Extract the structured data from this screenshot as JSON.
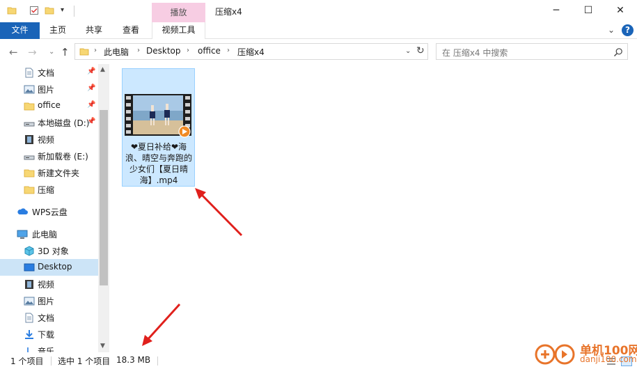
{
  "window": {
    "title": "压缩x4",
    "context_tab": "播放",
    "controls": {
      "minimize": "─",
      "maximize": "☐",
      "close": "✕"
    }
  },
  "ribbon": {
    "tabs": [
      {
        "label": "文件"
      },
      {
        "label": "主页"
      },
      {
        "label": "共享"
      },
      {
        "label": "查看"
      },
      {
        "label": "视频工具"
      }
    ],
    "help": "?"
  },
  "address": {
    "breadcrumbs": [
      "此电脑",
      "Desktop",
      "office",
      "压缩x4"
    ],
    "separator": "›"
  },
  "search": {
    "placeholder": "在 压缩x4 中搜索"
  },
  "sidebar": {
    "items": [
      {
        "label": "文档",
        "icon": "document-icon",
        "pinned": true
      },
      {
        "label": "图片",
        "icon": "picture-icon",
        "pinned": true
      },
      {
        "label": "office",
        "icon": "folder-icon",
        "pinned": true
      },
      {
        "label": "本地磁盘 (D:)",
        "icon": "drive-icon",
        "pinned": true
      },
      {
        "label": "视频",
        "icon": "video-icon",
        "pinned": false
      },
      {
        "label": "新加载卷 (E:)",
        "icon": "drive-icon",
        "pinned": false
      },
      {
        "label": "新建文件夹",
        "icon": "folder-icon",
        "pinned": false
      },
      {
        "label": "压缩",
        "icon": "folder-icon",
        "pinned": false
      },
      {
        "label": "WPS云盘",
        "icon": "cloud-icon",
        "pinned": false
      },
      {
        "label": "此电脑",
        "icon": "computer-icon",
        "pinned": false
      },
      {
        "label": "3D 对象",
        "icon": "3d-objects-icon",
        "pinned": false
      },
      {
        "label": "Desktop",
        "icon": "desktop-icon",
        "pinned": false,
        "selected": true
      },
      {
        "label": "视频",
        "icon": "video-icon",
        "pinned": false
      },
      {
        "label": "图片",
        "icon": "picture-icon",
        "pinned": false
      },
      {
        "label": "文档",
        "icon": "document-icon",
        "pinned": false
      },
      {
        "label": "下载",
        "icon": "download-icon",
        "pinned": false
      },
      {
        "label": "音乐",
        "icon": "music-icon",
        "pinned": false
      }
    ]
  },
  "content": {
    "file": {
      "name": "❤夏日补给❤海浪、晴空与奔跑的少女们【夏日晴海】.mp4",
      "type_icon": "video-file-icon"
    }
  },
  "status": {
    "item_count": "1 个项目",
    "selected": "选中 1 个项目",
    "size": "18.3 MB"
  },
  "watermark": {
    "title": "单机100网",
    "url": "danji100.com"
  },
  "colors": {
    "accent": "#1a64b8",
    "context_tab": "#f7cde3",
    "selection": "#cce8ff",
    "annotation_arrow": "#e0201c",
    "watermark": "#e8742a"
  }
}
